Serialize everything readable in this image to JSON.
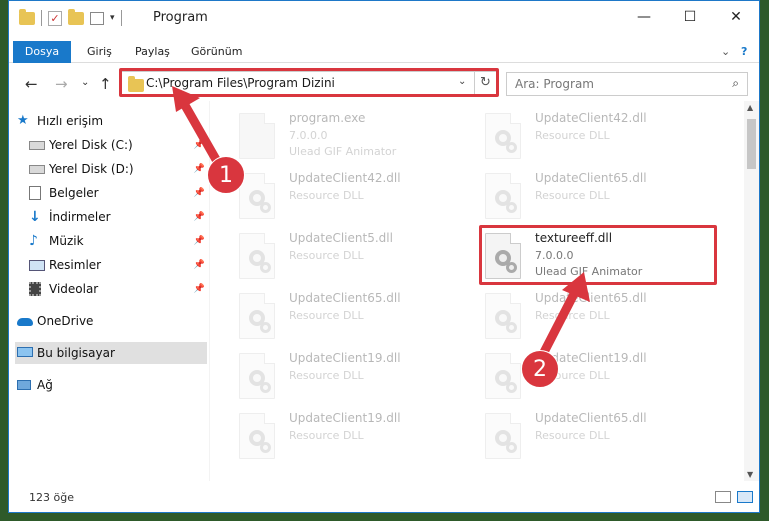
{
  "window": {
    "title": "Program",
    "controls": {
      "minimize": "—",
      "maximize": "☐",
      "close": "✕"
    }
  },
  "ribbon": {
    "tabs": [
      "Dosya",
      "Giriş",
      "Paylaş",
      "Görünüm"
    ]
  },
  "nav": {
    "back": "←",
    "forward": "→",
    "recent": "⌄",
    "up": "↑",
    "address": "C:\\Program Files\\Program Dizini",
    "refresh": "↻",
    "search_placeholder": "Ara: Program"
  },
  "sidebar": {
    "items": [
      {
        "label": "Hızlı erişim",
        "icon": "star-icon",
        "pinned": false
      },
      {
        "label": "Yerel Disk (C:)",
        "icon": "drive-icon",
        "pinned": true
      },
      {
        "label": "Yerel Disk (D:)",
        "icon": "drive-icon",
        "pinned": true
      },
      {
        "label": "Belgeler",
        "icon": "documents-icon",
        "pinned": true
      },
      {
        "label": "İndirmeler",
        "icon": "download-icon",
        "pinned": true
      },
      {
        "label": "Müzik",
        "icon": "music-icon",
        "pinned": true
      },
      {
        "label": "Resimler",
        "icon": "pictures-icon",
        "pinned": true
      },
      {
        "label": "Videolar",
        "icon": "video-icon",
        "pinned": true
      },
      {
        "label": "OneDrive",
        "icon": "cloud-icon",
        "pinned": false
      },
      {
        "label": "Bu bilgisayar",
        "icon": "computer-icon",
        "pinned": false
      },
      {
        "label": "Ağ",
        "icon": "network-icon",
        "pinned": false
      }
    ]
  },
  "files": [
    {
      "name": "program.exe",
      "line2": "7.0.0.0",
      "line3": "Ulead GIF Animator"
    },
    {
      "name": "UpdateClient42.dll",
      "line2": "Resource DLL",
      "line3": ""
    },
    {
      "name": "UpdateClient42.dll",
      "line2": "Resource DLL",
      "line3": ""
    },
    {
      "name": "UpdateClient65.dll",
      "line2": "Resource DLL",
      "line3": ""
    },
    {
      "name": "UpdateClient5.dll",
      "line2": "Resource DLL",
      "line3": ""
    },
    {
      "name": "textureeff.dll",
      "line2": "7.0.0.0",
      "line3": "Ulead GIF Animator"
    },
    {
      "name": "UpdateClient65.dll",
      "line2": "Resource DLL",
      "line3": ""
    },
    {
      "name": "UpdateClient65.dll",
      "line2": "Resource DLL",
      "line3": ""
    },
    {
      "name": "UpdateClient19.dll",
      "line2": "Resource DLL",
      "line3": ""
    },
    {
      "name": "UpdateClient19.dll",
      "line2": "Resource DLL",
      "line3": ""
    },
    {
      "name": "UpdateClient19.dll",
      "line2": "Resource DLL",
      "line3": ""
    },
    {
      "name": "UpdateClient65.dll",
      "line2": "Resource DLL",
      "line3": ""
    }
  ],
  "status": {
    "count": "123 öğe"
  },
  "annotations": {
    "step1": "1",
    "step2": "2",
    "color": "#d9363e"
  }
}
